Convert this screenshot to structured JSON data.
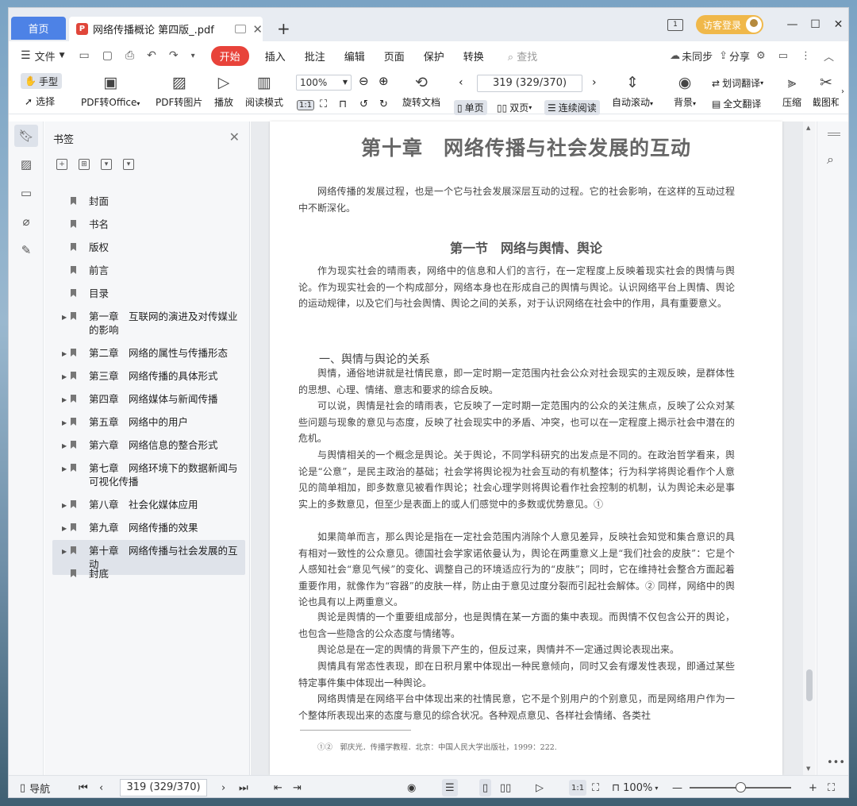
{
  "titlebar": {
    "home_tab": "首页",
    "doc_tab_title": "网络传播概论 第四版_.pdf",
    "pdf_icon_glyph": "P",
    "page_indicator_glyph": "1",
    "login_label": "访客登录",
    "minimize": "—",
    "maximize": "☐",
    "close": "✕",
    "new_tab": "+"
  },
  "menubar": {
    "file_label": "文件",
    "items": [
      "开始",
      "插入",
      "批注",
      "编辑",
      "页面",
      "保护",
      "转换"
    ],
    "search_placeholder": "查找",
    "sync_label": "未同步",
    "share_label": "分享"
  },
  "ribbon": {
    "hand_label": "手型",
    "select_label": "选择",
    "pdf_to_office": "PDF转Office",
    "pdf_to_image": "PDF转图片",
    "play": "播放",
    "read_mode": "阅读模式",
    "zoom_value": "100%",
    "page_value": "319 (329/370)",
    "rotate": "旋转文档",
    "single_page": "单页",
    "double_page": "双页",
    "continuous": "连续阅读",
    "auto_scroll": "自动滚动",
    "background": "背景",
    "word_translate": "划词翻译",
    "full_translate": "全文翻译",
    "compress": "压缩",
    "screenshot": "截图和"
  },
  "bookmarks": {
    "title": "书签",
    "items": [
      {
        "label": "封面",
        "expandable": false
      },
      {
        "label": "书名",
        "expandable": false
      },
      {
        "label": "版权",
        "expandable": false
      },
      {
        "label": "前言",
        "expandable": false
      },
      {
        "label": "目录",
        "expandable": false
      },
      {
        "label": "第一章　互联网的演进及对传媒业的影响",
        "expandable": true
      },
      {
        "label": "第二章　网络的属性与传播形态",
        "expandable": true
      },
      {
        "label": "第三章　网络传播的具体形式",
        "expandable": true
      },
      {
        "label": "第四章　网络媒体与新闻传播",
        "expandable": true
      },
      {
        "label": "第五章　网络中的用户",
        "expandable": true
      },
      {
        "label": "第六章　网络信息的整合形式",
        "expandable": true
      },
      {
        "label": "第七章　网络环境下的数据新闻与可视化传播",
        "expandable": true
      },
      {
        "label": "第八章　社会化媒体应用",
        "expandable": true
      },
      {
        "label": "第九章　网络传播的效果",
        "expandable": true
      },
      {
        "label": "第十章　网络传播与社会发展的互动",
        "expandable": true,
        "active": true
      },
      {
        "label": "封底",
        "expandable": false
      }
    ]
  },
  "doc": {
    "title": "第十章　网络传播与社会发展的互动",
    "intro": "网络传播的发展过程，也是一个它与社会发展深层互动的过程。它的社会影响，在这样的互动过程中不断深化。",
    "section": "第一节　网络与舆情、舆论",
    "section_para": "作为现实社会的晴雨表，网络中的信息和人们的言行，在一定程度上反映着现实社会的舆情与舆论。作为现实社会的一个构成部分，网络本身也在形成自己的舆情与舆论。认识网络平台上舆情、舆论的运动规律，以及它们与社会舆情、舆论之间的关系，对于认识网络在社会中的作用，具有重要意义。",
    "subsection": "一、舆情与舆论的关系",
    "paras": [
      "舆情，通俗地讲就是社情民意，即一定时期一定范围内社会公众对社会现实的主观反映，是群体性的思想、心理、情绪、意志和要求的综合反映。",
      "可以说，舆情是社会的晴雨表，它反映了一定时期一定范围内的公众的关注焦点，反映了公众对某些问题与现象的意见与态度，反映了社会现实中的矛盾、冲突，也可以在一定程度上揭示社会中潜在的危机。",
      "与舆情相关的一个概念是舆论。关于舆论，不同学科研究的出发点是不同的。在政治哲学看来，舆论是“公意”，是民主政治的基础；社会学将舆论视为社会互动的有机整体；行为科学将舆论看作个人意见的简单相加，即多数意见被看作舆论；社会心理学则将舆论看作社会控制的机制，认为舆论未必是事实上的多数意见，但至少是表面上的或人们感觉中的多数或优势意见。①",
      "如果简单而言，那么舆论是指在一定社会范围内消除个人意见差异，反映社会知觉和集合意识的具有相对一致性的公众意见。德国社会学家诺依曼认为，舆论在两重意义上是“我们社会的皮肤”：它是个人感知社会“意见气候”的变化、调整自己的环境适应行为的“皮肤”；同时，它在维持社会整合方面起着重要作用，就像作为“容器”的皮肤一样，防止由于意见过度分裂而引起社会解体。② 同样，网络中的舆论也具有以上两重意义。",
      "舆论是舆情的一个重要组成部分，也是舆情在某一方面的集中表现。而舆情不仅包含公开的舆论，也包含一些隐含的公众态度与情绪等。",
      "舆论总是在一定的舆情的背景下产生的，但反过来，舆情并不一定通过舆论表现出来。",
      "舆情具有常态性表现，即在日积月累中体现出一种民意倾向，同时又会有爆发性表现，即通过某些特定事件集中体现出一种舆论。",
      "网络舆情是在网络平台中体现出来的社情民意，它不是个别用户的个别意见，而是网络用户作为一个整体所表现出来的态度与意见的综合状况。各种观点意见、各样社会情绪、各类社"
    ],
    "footnote": "①②　郭庆光．传播学教程．北京：中国人民大学出版社，1999：222."
  },
  "statusbar": {
    "nav_label": "导航",
    "page_value": "319 (329/370)",
    "zoom_value": "100%",
    "zoom_level_fraction": 0.5
  },
  "colors": {
    "accent": "#4d82e6",
    "menu_active": "#e8433a",
    "login": "#f0b84a"
  }
}
